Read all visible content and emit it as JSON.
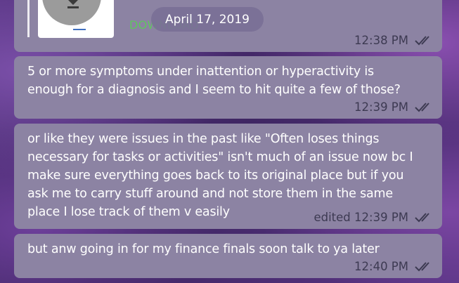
{
  "date_separator": "April 17, 2019",
  "document": {
    "download_label": "DOWNLOAD"
  },
  "messages": [
    {
      "time": "12:38 PM",
      "status": "read"
    },
    {
      "lines": [
        "5 or more symptoms under inattention or hyperactivity is",
        "enough for a diagnosis and I seem to hit quite a few of those?"
      ],
      "time": "12:39 PM",
      "status": "read"
    },
    {
      "lines": [
        "or like they were issues in the past like \"Often loses things",
        "necessary for tasks or activities\" isn't much of an issue now bc I",
        "make sure everything goes back to its original place but if you",
        "ask me to carry stuff around and not store them in the same",
        "place I lose track of them v easily"
      ],
      "time": "edited 12:39 PM",
      "status": "read"
    },
    {
      "lines": [
        "but anw going in for my finance finals soon talk to ya later"
      ],
      "time": "12:40 PM",
      "status": "read"
    }
  ],
  "colors": {
    "bubble": "#8c83a3",
    "meta_text": "#3d3a52",
    "download_label": "#5fc55f",
    "wallpaper": "#4a2d6e"
  }
}
